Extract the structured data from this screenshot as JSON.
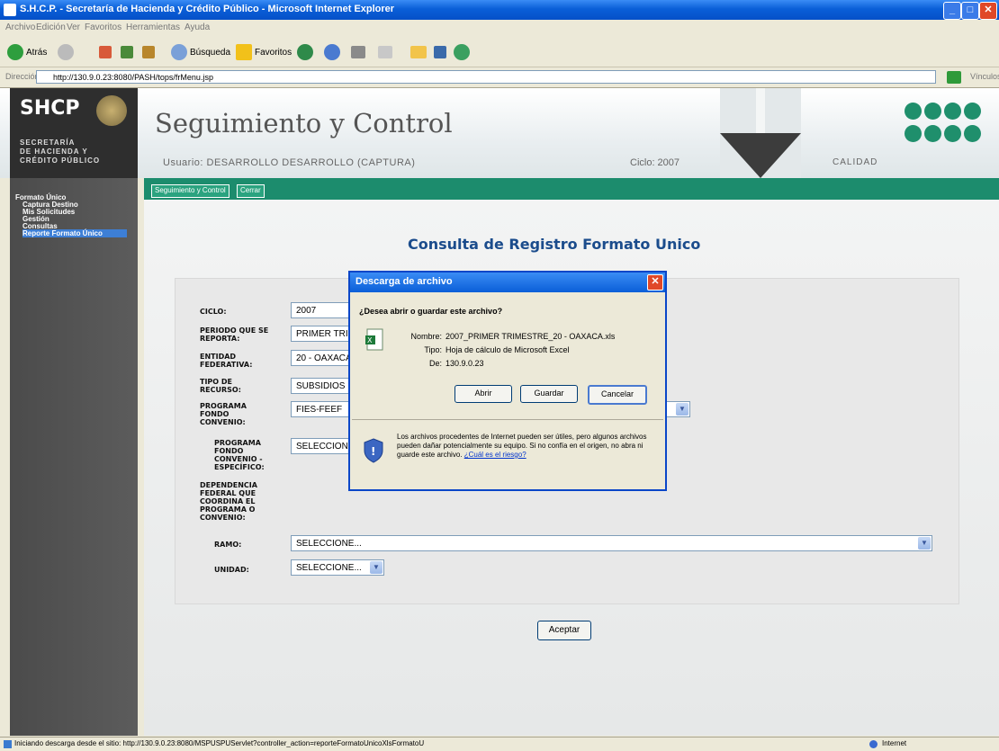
{
  "browser": {
    "title": "S.H.C.P. - Secretaría de Hacienda y Crédito Público - Microsoft Internet Explorer",
    "menu": [
      "Archivo",
      "Edición",
      "Ver",
      "Favoritos",
      "Herramientas",
      "Ayuda"
    ],
    "toolbar": {
      "back": "Atrás",
      "search": "Búsqueda",
      "favorites": "Favoritos"
    },
    "address_label": "Dirección",
    "address": "http://130.9.0.23:8080/PASH/tops/frMenu.jsp",
    "links_label": "Vínculos",
    "status_text": "Iniciando descarga desde el sitio: http://130.9.0.23:8080/MSPUSPUServlet?controller_action=reporteFormatoUnicoXlsFormatoU",
    "zone": "Internet"
  },
  "header": {
    "logo_big": "SHCP",
    "logo_lines": [
      "SECRETARÍA",
      "DE HACIENDA Y",
      "CRÉDITO PÚBLICO"
    ],
    "app_title": "Seguimiento y Control",
    "user_line": "Usuario: DESARROLLO DESARROLLO (CAPTURA)",
    "ciclo": "Ciclo: 2007",
    "calidad": "CALIDAD"
  },
  "tabs": [
    "Seguimiento y Control",
    "Cerrar"
  ],
  "sidebar": {
    "heading": "Formato Único",
    "items": [
      "Captura Destino",
      "Mis Solicitudes",
      "Gestión",
      "Consultas",
      "Reporte Formato Único"
    ]
  },
  "page_title": "Consulta de Registro Formato Unico",
  "form": {
    "ciclo_label": "CICLO:",
    "ciclo_value": "2007",
    "periodo_label": "PERIODO QUE SE REPORTA:",
    "periodo_value": "PRIMER TRIMESTRE",
    "entidad_label": "ENTIDAD FEDERATIVA:",
    "entidad_value": "20 - OAXACA",
    "tipo_label": "TIPO DE RECURSO:",
    "tipo_value": "SUBSIDIOS",
    "programa_label": "PROGRAMA FONDO CONVENIO:",
    "programa_value": "FIES-FEEF",
    "programa_esp_label": "PROGRAMA FONDO CONVENIO - ESPECÍFICO:",
    "programa_esp_value": "SELECCIONE...",
    "dependencia_label": "DEPENDENCIA FEDERAL QUE COORDINA EL PROGRAMA O CONVENIO:",
    "ramo_label": "RAMO:",
    "ramo_value": "SELECCIONE...",
    "unidad_label": "UNIDAD:",
    "unidad_value": "SELECCIONE...",
    "aceptar": "Aceptar"
  },
  "dialog": {
    "title": "Descarga de archivo",
    "question": "¿Desea abrir o guardar este archivo?",
    "name_label": "Nombre:",
    "name_value": "2007_PRIMER TRIMESTRE_20 - OAXACA.xls",
    "type_label": "Tipo:",
    "type_value": "Hoja de cálculo de Microsoft Excel",
    "from_label": "De:",
    "from_value": "130.9.0.23",
    "open": "Abrir",
    "save": "Guardar",
    "cancel": "Cancelar",
    "warning": "Los archivos procedentes de Internet pueden ser útiles, pero algunos archivos pueden dañar potencialmente su equipo. Si no confía en el origen, no abra ni guarde este archivo.",
    "risk_link": "¿Cuál es el riesgo?"
  }
}
